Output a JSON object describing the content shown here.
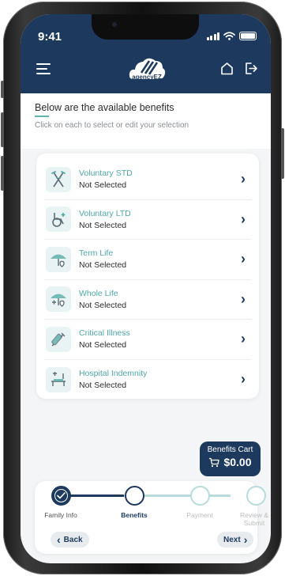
{
  "status_bar": {
    "time": "9:41"
  },
  "header": {
    "menu_icon": "hamburger-menu-icon",
    "logo_text": "agencyEZ",
    "home_icon": "home-icon",
    "logout_icon": "logout-icon"
  },
  "intro": {
    "title": "Below are the available benefits",
    "subtitle": "Click on each to select or edit your selection"
  },
  "benefits": [
    {
      "name": "Voluntary STD",
      "status": "Not Selected",
      "icon": "crutches-icon"
    },
    {
      "name": "Voluntary LTD",
      "status": "Not Selected",
      "icon": "wheelchair-icon"
    },
    {
      "name": "Term Life",
      "status": "Not Selected",
      "icon": "umbrella-heart-icon"
    },
    {
      "name": "Whole Life",
      "status": "Not Selected",
      "icon": "umbrella-heart-plus-icon"
    },
    {
      "name": "Critical Illness",
      "status": "Not Selected",
      "icon": "syringe-icon"
    },
    {
      "name": "Hospital Indemnity",
      "status": "Not Selected",
      "icon": "hospital-bed-icon"
    }
  ],
  "cart": {
    "label": "Benefits Cart",
    "total": "$0.00",
    "icon": "cart-icon"
  },
  "stepper": {
    "steps": [
      {
        "label": "Family Info",
        "state": "done"
      },
      {
        "label": "Benefits",
        "state": "current"
      },
      {
        "label": "Payment",
        "state": "todo"
      },
      {
        "label": "Review & Submit",
        "state": "todo"
      }
    ]
  },
  "nav": {
    "back_label": "Back",
    "next_label": "Next"
  },
  "colors": {
    "primary": "#1d3a5e",
    "accent": "#4ea9a6",
    "background": "#f3f5f6"
  }
}
